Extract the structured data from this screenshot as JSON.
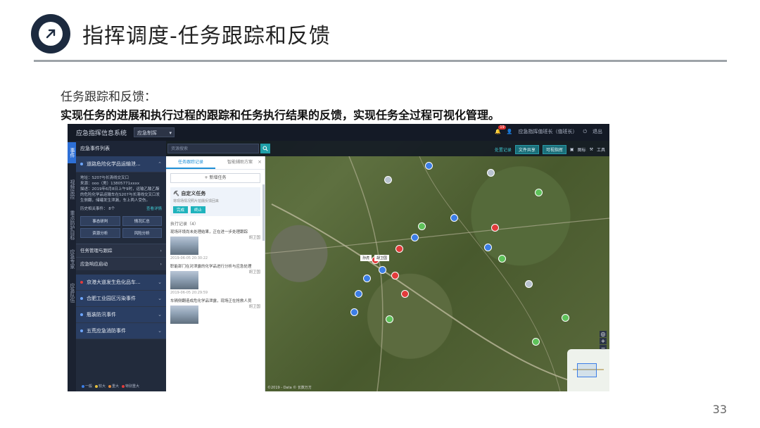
{
  "slide": {
    "title": "指挥调度-任务跟踪和反馈",
    "subheading": "任务跟踪和反馈：",
    "description": "实现任务的进展和执行过程的跟踪和任务执行结果的反馈，实现任务全过程可视化管理。",
    "page_number": "33"
  },
  "app": {
    "title": "应急指挥信息系统",
    "mode_select": "应急制挥",
    "notification_count": "19",
    "user": "应急指挥值班长（值班长）",
    "logout": "退出"
  },
  "vertical_tabs": [
    "事件",
    "视频监控",
    "重点防护目标",
    "应急专家",
    "应急队伍"
  ],
  "sidebar": {
    "header": "应急事件列表",
    "primary_event": "道路危险化学品运输泄...",
    "details": [
      "地址：S207与长清线交叉口",
      "来源：ooo（男）13805771xxxx",
      "描述：2019年6月8日上午9时，运输乙酸乙酯的危险化学品运输车在S207与长清线交叉口发生侧翻，储罐发生泄漏，车上两人受伤。"
    ],
    "history_label": "历史相关事件：",
    "history_count": "8个",
    "history_link": "查看详情",
    "buttons": [
      "事态研判",
      "情况汇总",
      "资源分析",
      "风险分析"
    ],
    "sections": [
      "任务管理与跟踪",
      "应急响应启动"
    ],
    "events": [
      "京港大道发生危化品车...",
      "合肥工业园区污染事件",
      "瓶装防汛事件",
      "五荒应急消防事件"
    ],
    "legend": [
      {
        "label": "一般",
        "color": "#3c7ee6"
      },
      {
        "label": "较大",
        "color": "#e6c13c"
      },
      {
        "label": "重大",
        "color": "#e68a3c"
      },
      {
        "label": "特别重大",
        "color": "#e23b3b"
      }
    ]
  },
  "map_toolbar": {
    "search_placeholder": "资源搜索",
    "link": "处置记录",
    "chips": [
      "文件共享",
      "可视指挥"
    ],
    "tools": [
      "图标",
      "工具"
    ]
  },
  "panel": {
    "tabs": [
      "任务跟踪记录",
      "智能辅助方案"
    ],
    "add_task": "+ 新增任务",
    "custom_title": "自定义任务",
    "custom_desc": "将现场情况照片拍摄反馈回来",
    "custom_buttons": [
      "完成",
      "终止"
    ],
    "records_header": "执行记录（4）",
    "records": [
      {
        "text": "现场环境尚未处理结果，正在进一步处理跟踪",
        "who": "胡卫国",
        "time": "2019-06-05 20:30:22"
      },
      {
        "text": "职能部门在对泄露的化学品进行分析与应急处理",
        "who": "胡卫国",
        "time": "2019-06-05 20:29:59"
      },
      {
        "text": "车辆侧翻造成危化学品泄露，现场正在抢救人员",
        "who": "胡卫国",
        "time": ""
      }
    ]
  },
  "map": {
    "labels": [
      "孙虎",
      "胡卫国"
    ],
    "copyright": "©2019 - Data © 长数万方"
  }
}
